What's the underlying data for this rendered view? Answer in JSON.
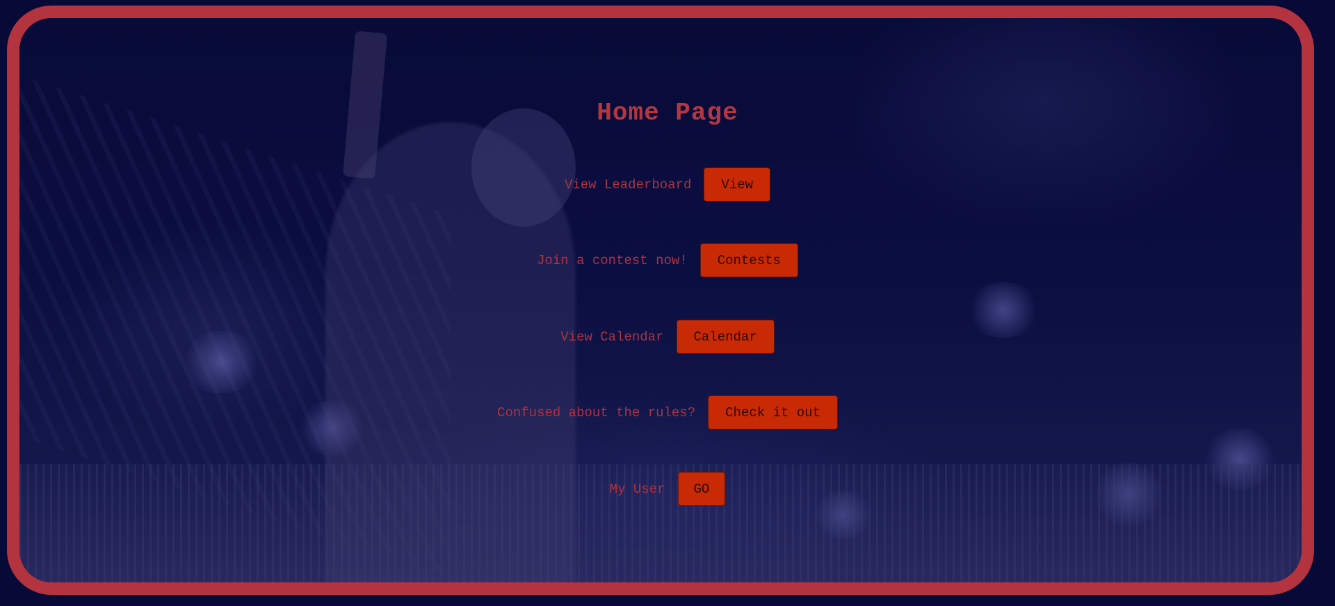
{
  "page": {
    "title": "Home Page"
  },
  "rows": [
    {
      "label": "View Leaderboard",
      "button": "View"
    },
    {
      "label": "Join a contest now!",
      "button": "Contests"
    },
    {
      "label": "View Calendar",
      "button": "Calendar"
    },
    {
      "label": "Confused about the rules?",
      "button": "Check it out"
    },
    {
      "label": "My User",
      "button": "GO"
    }
  ],
  "colors": {
    "frame": "#b3333f",
    "background": "#0a0d3c",
    "text": "#b3303d",
    "button": "#c92a06"
  }
}
